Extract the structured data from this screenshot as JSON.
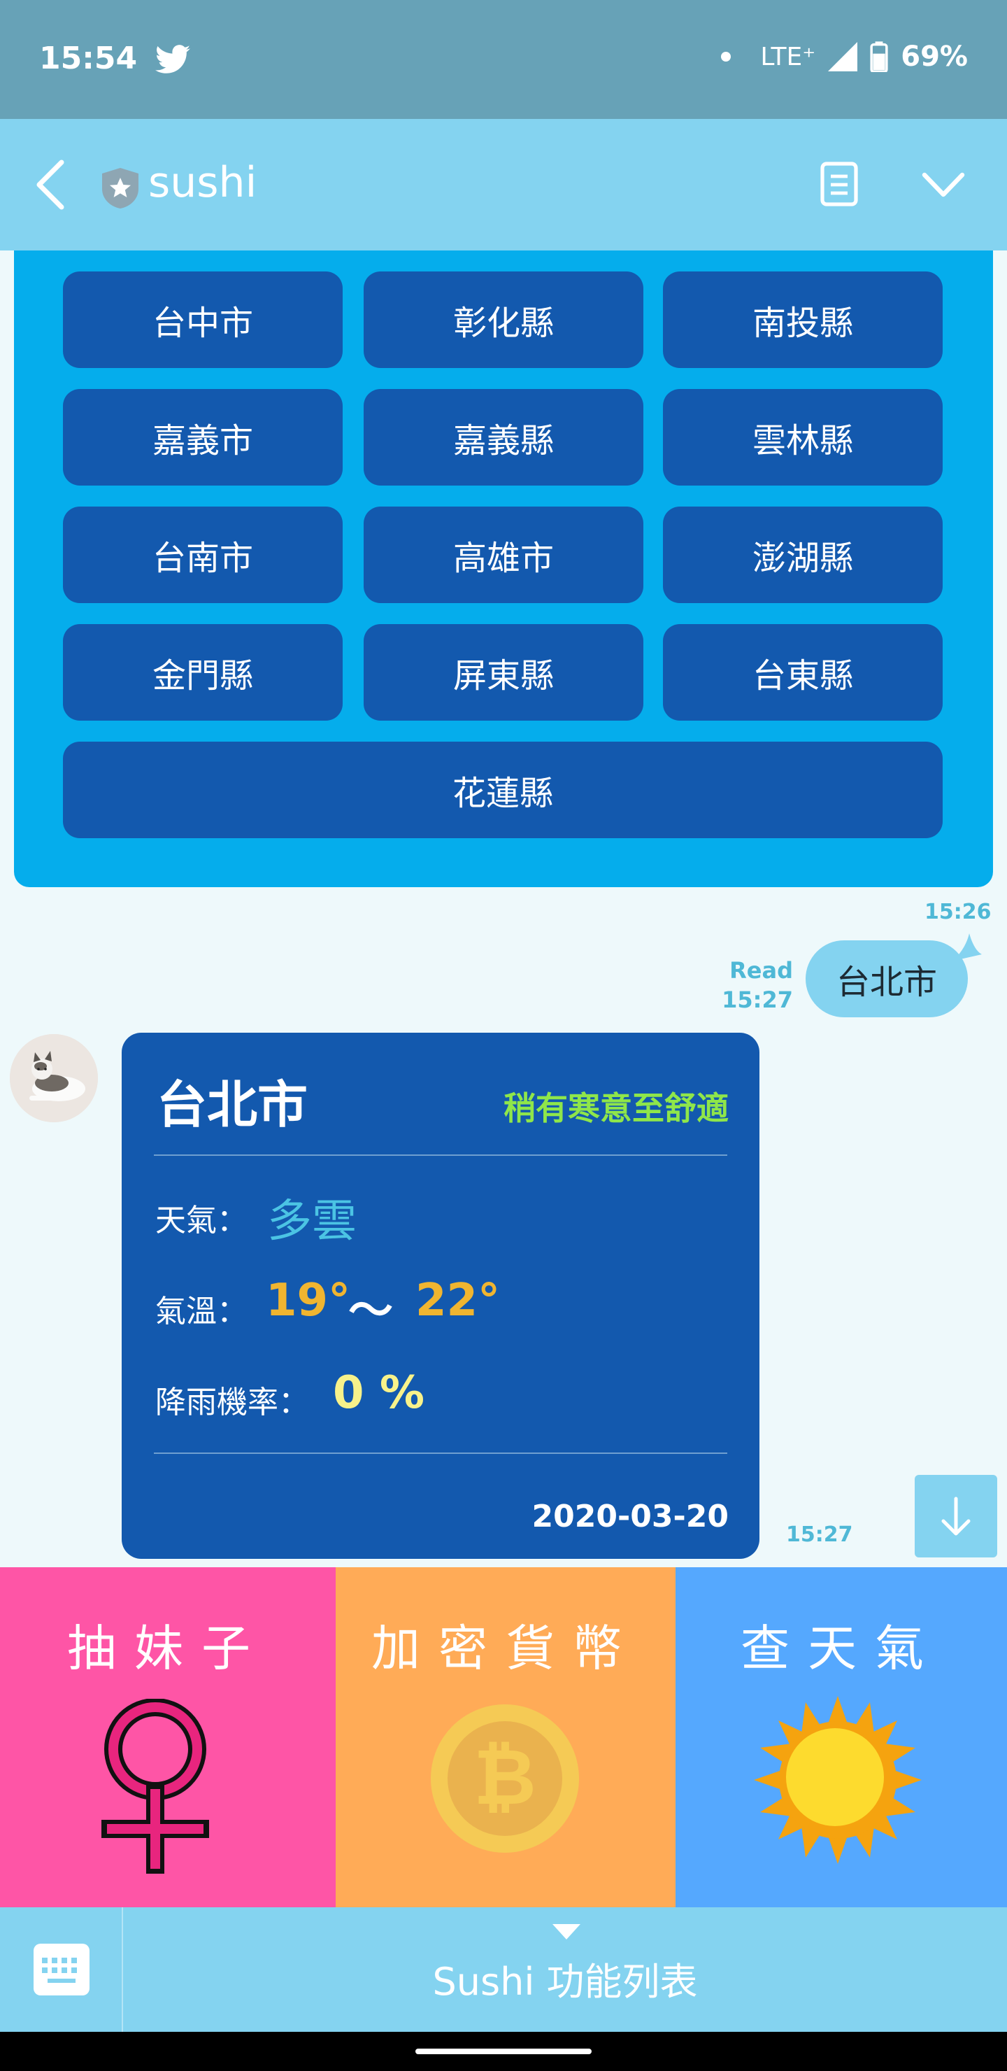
{
  "status_bar": {
    "time": "15:54",
    "network": "LTE⁺",
    "battery": "69%"
  },
  "header": {
    "title": "sushi"
  },
  "city_buttons": [
    "台中市",
    "彰化縣",
    "南投縣",
    "嘉義市",
    "嘉義縣",
    "雲林縣",
    "台南市",
    "高雄市",
    "澎湖縣",
    "金門縣",
    "屏東縣",
    "台東縣",
    "花蓮縣"
  ],
  "chat": {
    "bot_card_time": "15:26",
    "user_message": "台北市",
    "read_label": "Read",
    "user_message_time": "15:27",
    "weather_card_time": "15:27"
  },
  "weather": {
    "city": "台北市",
    "feel": "稍有寒意至舒適",
    "weather_label": "天氣：",
    "weather_value": "多雲",
    "temp_label": "氣溫：",
    "temp_low": "19°",
    "tilde": "～",
    "temp_high": "22°",
    "rain_label": "降雨機率：",
    "rain_value": "0 %",
    "date": "2020-03-20"
  },
  "rich_menu": {
    "items": [
      {
        "label": "抽妹子",
        "color": "#fe55a6"
      },
      {
        "label": "加密貨幣",
        "color": "#ffab57"
      },
      {
        "label": "查天氣",
        "color": "#55a8fe"
      }
    ]
  },
  "bottom_bar": {
    "menu_label": "Sushi 功能列表"
  },
  "colors": {
    "header": "#84d3f0",
    "card_blue": "#1359ae",
    "city_card_bg": "#05adec"
  }
}
